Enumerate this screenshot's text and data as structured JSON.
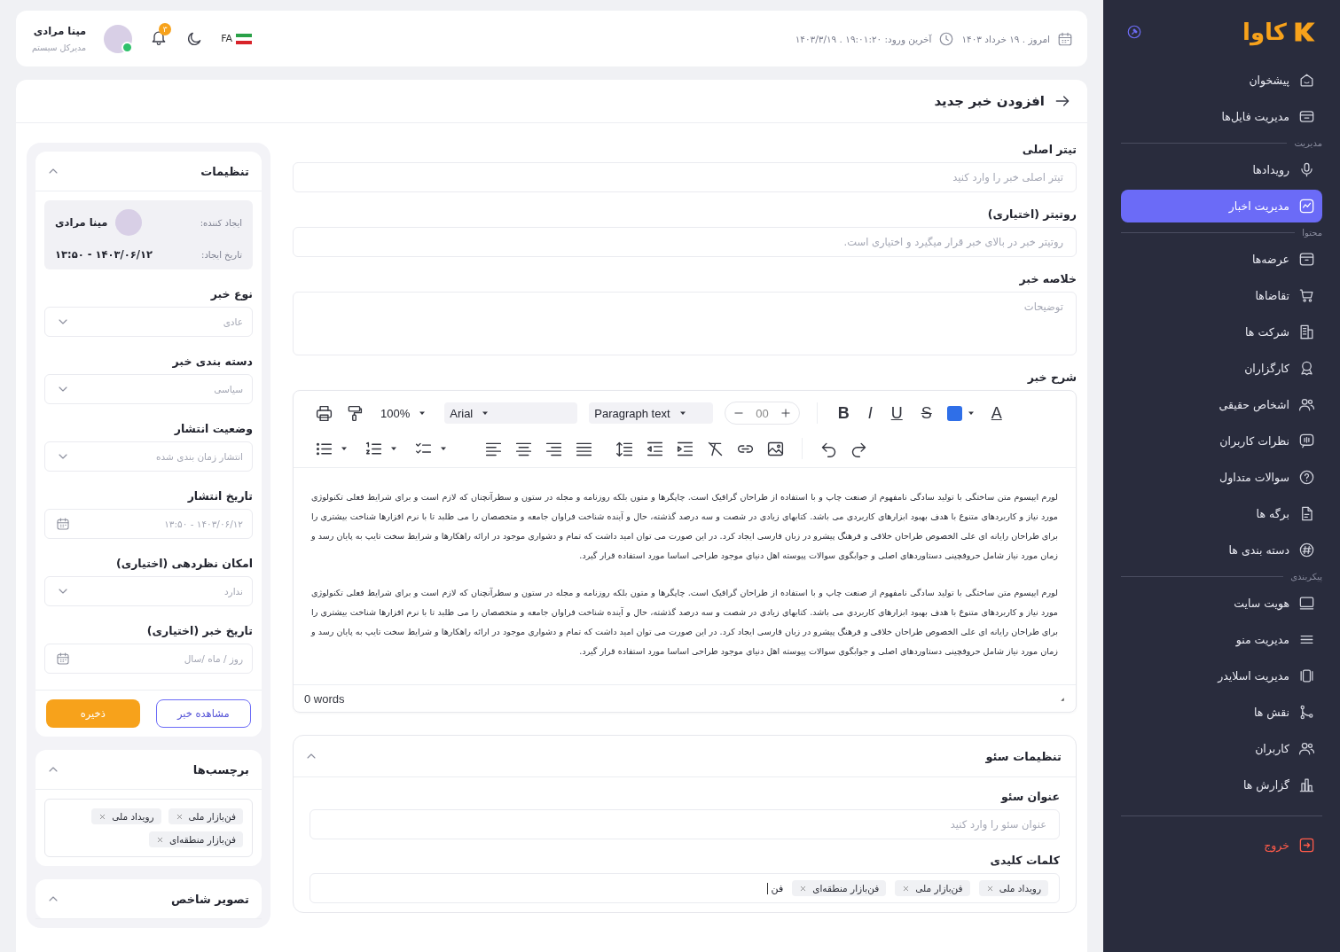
{
  "sidebar": {
    "logo": "کاوا",
    "items": [
      {
        "kind": "item",
        "label": "پیشخوان",
        "selected": false
      },
      {
        "kind": "item",
        "label": "مدیریت فایل‌ها",
        "selected": false
      },
      {
        "kind": "section",
        "label": "مدیریت"
      },
      {
        "kind": "item",
        "label": "رویدادها",
        "selected": false
      },
      {
        "kind": "item",
        "label": "مدیریت اخبار",
        "selected": true
      },
      {
        "kind": "section",
        "label": "محتوا"
      },
      {
        "kind": "item",
        "label": "عرضه‌ها",
        "selected": false
      },
      {
        "kind": "item",
        "label": "تقاضاها",
        "selected": false
      },
      {
        "kind": "item",
        "label": "شرکت ها",
        "selected": false
      },
      {
        "kind": "item",
        "label": "کارگزاران",
        "selected": false
      },
      {
        "kind": "item",
        "label": "اشخاص حقیقی",
        "selected": false
      },
      {
        "kind": "item",
        "label": "نظرات کاربران",
        "selected": false
      },
      {
        "kind": "item",
        "label": "سوالات متداول",
        "selected": false
      },
      {
        "kind": "item",
        "label": "برگه ها",
        "selected": false
      },
      {
        "kind": "item",
        "label": "دسته بندی ها",
        "selected": false
      },
      {
        "kind": "section",
        "label": "پیکربندی"
      },
      {
        "kind": "item",
        "label": "هویت سایت",
        "selected": false
      },
      {
        "kind": "item",
        "label": "مدیریت منو",
        "selected": false
      },
      {
        "kind": "item",
        "label": "مدیریت اسلایدر",
        "selected": false
      },
      {
        "kind": "item",
        "label": "نقش ها",
        "selected": false
      },
      {
        "kind": "item",
        "label": "کاربران",
        "selected": false
      },
      {
        "kind": "item",
        "label": "گزارش ها",
        "selected": false
      }
    ],
    "logout": "خروج"
  },
  "topbar": {
    "today": "امروز . ۱۹ خرداد ۱۴۰۳",
    "last_login": "آخرین ورود: ۱۹:۰۱:۲۰ . ۱۴۰۳/۳/۱۹",
    "language": "FA",
    "notification_count": "۳",
    "user_name": "مینا مرادی",
    "user_role": "مدیرکل سیستم"
  },
  "page": {
    "title": "افزودن خبر جدید"
  },
  "form": {
    "fields": [
      {
        "kind": "input",
        "label": "تیتر اصلی",
        "placeholder": "تیتر اصلی خبر را وارد کنید"
      },
      {
        "kind": "input",
        "label": "روتیتر (اختیاری)",
        "placeholder": "روتیتر خبر در بالای خبر قرار میگیرد و اختیاری است."
      },
      {
        "kind": "textarea",
        "label": "خلاصه خبر",
        "placeholder": "توضیحات"
      }
    ]
  },
  "editor": {
    "label": "شرح خبر",
    "zoom": "100%",
    "font": "Arial",
    "block": "Paragraph text",
    "size": "00",
    "format_buttons": [
      {
        "kind": "strike",
        "label": "S"
      },
      {
        "kind": "underline",
        "label": "U"
      },
      {
        "kind": "italic",
        "label": "I"
      },
      {
        "kind": "bold",
        "label": "B"
      }
    ],
    "font_color_label": "A",
    "paragraphs": [
      "لورم ایپسوم متن ساختگی با تولید سادگی نامفهوم از صنعت چاپ و با استفاده از طراحان گرافیک است. چاپگرها و متون بلکه روزنامه و مجله در ستون و سطرآنچنان که لازم است و برای شرایط فعلی تکنولوژی مورد نیاز و کاربردهای متنوع با هدف بهبود ابزارهای کاربردی می باشد. کتابهای زیادی در شصت و سه درصد گذشته، حال و آینده شناخت فراوان جامعه و متخصصان را می طلبد تا با نرم افزارها شناخت بیشتری را برای طراحان رایانه ای علی الخصوص طراحان خلاقی و فرهنگ پیشرو در زبان فارسی ایجاد کرد. در این صورت می توان امید داشت که تمام و دشواری موجود در ارائه راهکارها و شرایط سخت تایپ به پایان رسد و زمان مورد نیاز شامل حروفچینی دستاوردهای اصلی و جوابگوی سوالات پیوسته اهل دنیای موجود طراحی اساسا مورد استفاده قرار گیرد.",
      "لورم ایپسوم متن ساختگی با تولید سادگی نامفهوم از صنعت چاپ و با استفاده از طراحان گرافیک است. چاپگرها و متون بلکه روزنامه و مجله در ستون و سطرآنچنان که لازم است و برای شرایط فعلی تکنولوژی مورد نیاز و کاربردهای متنوع با هدف بهبود ابزارهای کاربردی می باشد. کتابهای زیادی در شصت و سه درصد گذشته، حال و آینده شناخت فراوان جامعه و متخصصان را می طلبد تا با نرم افزارها شناخت بیشتری را برای طراحان رایانه ای علی الخصوص طراحان خلاقی و فرهنگ پیشرو در زبان فارسی ایجاد کرد. در این صورت می توان امید داشت که تمام و دشواری موجود در ارائه راهکارها و شرایط سخت تایپ به پایان رسد و زمان مورد نیاز شامل حروفچینی دستاوردهای اصلی و جوابگوی سوالات پیوسته اهل دنیای موجود طراحی اساسا مورد استفاده قرار گیرد."
    ],
    "word_count": "0 words"
  },
  "seo": {
    "title": "تنظیمات سئو",
    "expanded": true,
    "title_field": {
      "label": "عنوان سئو",
      "placeholder": "عنوان سئو را وارد کنید"
    },
    "keywords": {
      "label": "کلمات کلیدی",
      "tags": [
        "رویداد ملی",
        "فن‌بازار ملی",
        "فن‌بازار منطقه‌ای"
      ],
      "value": "فن"
    }
  },
  "settings": {
    "title": "تنظیمات",
    "expanded": true,
    "creator_label": "ایجاد کننده:",
    "creator": "مینا مرادی",
    "created_label": "تاریخ ایجاد:",
    "created": "۱۴۰۳/۰۶/۱۲ - ۱۳:۵۰",
    "fields": [
      {
        "kind": "select",
        "label": "نوع خبر",
        "placeholder": "عادی"
      },
      {
        "kind": "select",
        "label": "دسته بندی خبر",
        "placeholder": "سیاسی"
      },
      {
        "kind": "select",
        "label": "وضعیت انتشار",
        "placeholder": "انتشار زمان بندی شده"
      },
      {
        "kind": "date",
        "label": "تاریخ انتشار",
        "placeholder": "۱۴۰۳/۰۶/۱۲ - ۱۳:۵۰"
      },
      {
        "kind": "select",
        "label": "امکان نظردهی (اختیاری)",
        "placeholder": "ندارد"
      },
      {
        "kind": "date",
        "label": "تاریخ خبر (اختیاری)",
        "placeholder": "روز / ماه /سال"
      }
    ],
    "preview_button": "مشاهده خبر",
    "save_button": "ذخیره"
  },
  "tags_panel": {
    "title": "برچسب‌ها",
    "expanded": true,
    "tags": [
      "فن‌بازار ملی",
      "رویداد ملی",
      "فن‌بازار منطقه‌ای"
    ]
  },
  "image_panel": {
    "title": "تصویر شاخص",
    "expanded": true
  }
}
